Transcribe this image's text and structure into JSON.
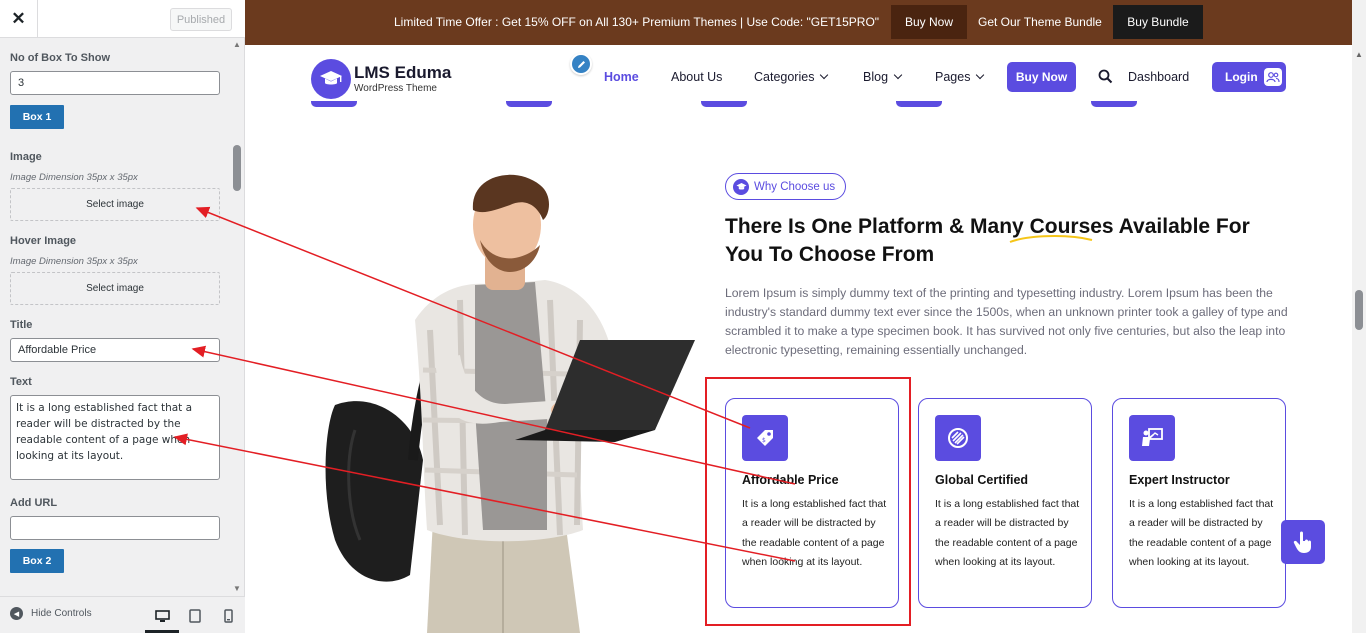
{
  "sidebar": {
    "close_icon": "close-icon",
    "published_label": "Published",
    "no_of_box_label": "No of Box To Show",
    "no_of_box_value": "3",
    "box1_label": "Box 1",
    "image_label": "Image",
    "image_dimension": "Image Dimension 35px x 35px",
    "select_image_label": "Select image",
    "hover_image_label": "Hover Image",
    "hover_image_dimension": "Image Dimension 35px x 35px",
    "hover_select_image_label": "Select image",
    "title_label": "Title",
    "title_value": "Affordable Price",
    "text_label": "Text",
    "text_value": "It is a long established fact that a reader will be distracted by the readable content of a page when looking at its layout.",
    "add_url_label": "Add URL",
    "add_url_value": "",
    "box2_label": "Box 2",
    "hide_controls_label": "Hide Controls"
  },
  "offer_bar": {
    "text": "Limited Time Offer : Get 15% OFF on All 130+ Premium Themes | Use Code: \"GET15PRO\"",
    "buy_now_label": "Buy Now",
    "bundle_text": "Get Our Theme Bundle",
    "buy_bundle_label": "Buy Bundle",
    "background": "#6b3a1e"
  },
  "nav": {
    "logo_title": "LMS Eduma",
    "logo_subtitle": "WordPress Theme",
    "items": [
      {
        "label": "Home",
        "active": true
      },
      {
        "label": "About Us"
      },
      {
        "label": "Categories",
        "dropdown": true
      },
      {
        "label": "Blog",
        "dropdown": true
      },
      {
        "label": "Pages",
        "dropdown": true
      }
    ],
    "buy_now_label": "Buy Now",
    "dashboard_label": "Dashboard",
    "login_label": "Login"
  },
  "section": {
    "badge_label": "Why Choose us",
    "heading": "There Is One Platform & Many Courses Available For You To Choose From",
    "paragraph": "Lorem Ipsum is simply dummy text of the printing and typesetting industry. Lorem Ipsum has been the industry's standard dummy text ever since the 1500s, when an unknown printer took a galley of type and scrambled it to make a type specimen book. It has survived not only five centuries, but also the leap into electronic typesetting, remaining essentially unchanged.",
    "cards": [
      {
        "icon": "price-tag-icon",
        "title": "Affordable Price",
        "text": "It is a long established fact that a reader will be distracted by the readable content of a page when looking at its layout."
      },
      {
        "icon": "certificate-icon",
        "title": "Global Certified",
        "text": "It is a long established fact that a reader will be distracted by the readable content of a page when looking at its layout."
      },
      {
        "icon": "instructor-icon",
        "title": "Expert Instructor",
        "text": "It is a long established fact that a reader will be distracted by the readable content of a page when looking at its layout."
      }
    ]
  },
  "colors": {
    "accent": "#5b4ce0",
    "wp_blue": "#2271b1",
    "annotation_red": "#e31e24"
  }
}
